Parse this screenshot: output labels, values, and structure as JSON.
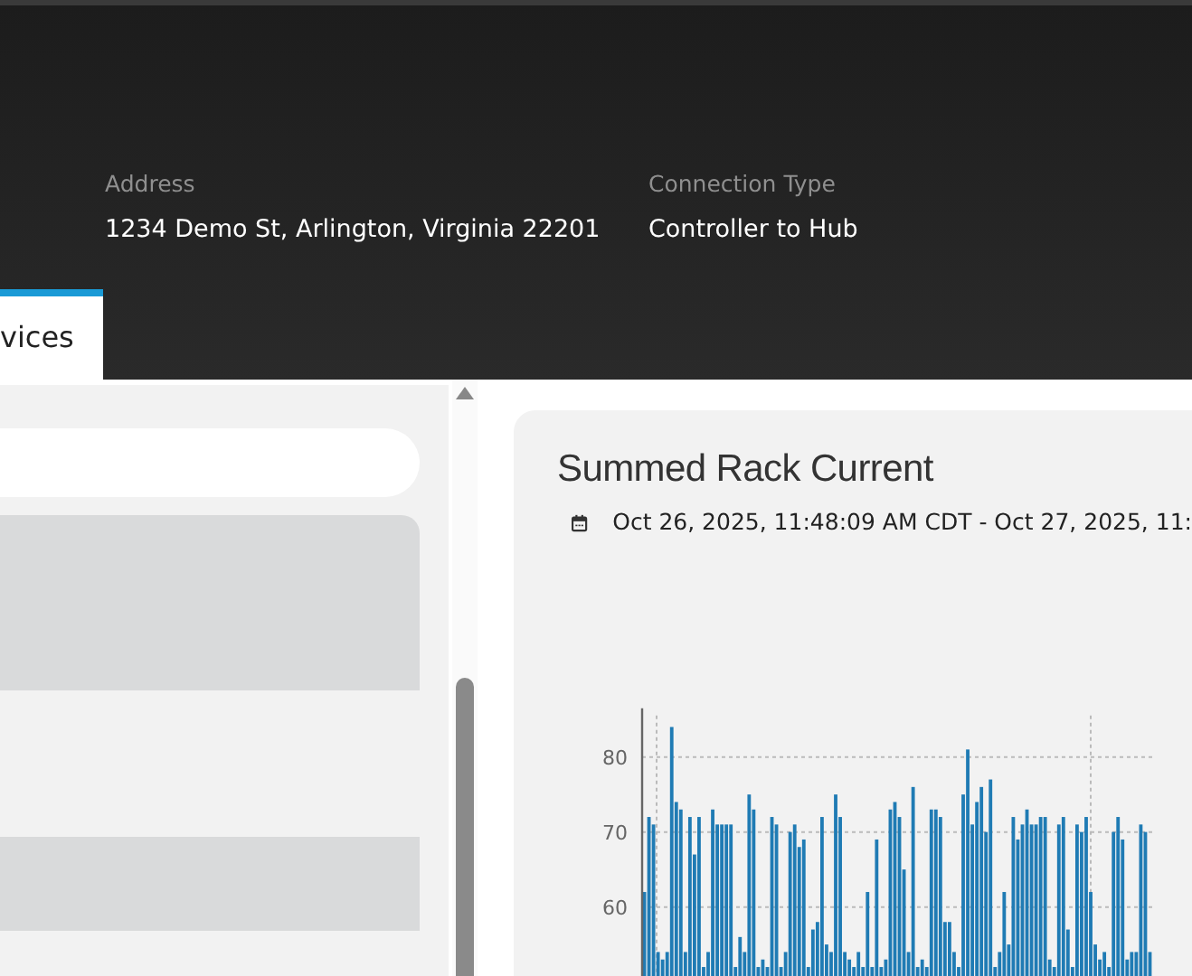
{
  "header": {
    "fields": [
      {
        "label": "Address",
        "value": "1234 Demo St, Arlington, Virginia 22201"
      },
      {
        "label": "Connection Type",
        "value": "Controller to Hub"
      }
    ]
  },
  "tabs": [
    {
      "label": "vices",
      "selected": true
    }
  ],
  "sidebar": {
    "search": {
      "kind": "field"
    },
    "items": [
      {
        "selected": true
      },
      {
        "selected": true
      }
    ]
  },
  "panel": {
    "title": "Summed Rack Current",
    "date_range": "Oct 26, 2025, 11:48:09 AM CDT - Oct 27, 2025, 11:",
    "chart_data": {
      "type": "bar",
      "grid": true,
      "ylim": [
        50.8,
        86
      ],
      "yticks": [
        60,
        70,
        80
      ],
      "values": [
        62,
        72,
        71,
        54,
        53,
        54,
        84,
        74,
        73,
        54,
        72,
        67,
        72,
        52,
        54,
        73,
        71,
        71,
        71,
        71,
        52,
        56,
        54,
        75,
        73,
        52,
        53,
        52,
        72,
        71,
        52,
        54,
        70,
        71,
        68,
        69,
        52,
        57,
        58,
        72,
        55,
        54,
        75,
        72,
        54,
        53,
        52,
        54,
        52,
        62,
        52,
        69,
        52,
        53,
        73,
        74,
        72,
        65,
        54,
        76,
        52,
        53,
        52,
        73,
        73,
        72,
        58,
        58,
        54,
        52,
        75,
        81,
        71,
        74,
        76,
        70,
        77,
        52,
        54,
        62,
        55,
        72,
        69,
        71,
        73,
        71,
        71,
        72,
        72,
        53,
        52,
        71,
        72,
        57,
        52,
        71,
        70,
        72,
        62,
        55,
        53,
        54,
        52,
        70,
        72,
        69,
        53,
        54,
        54,
        71,
        70,
        54
      ]
    }
  }
}
